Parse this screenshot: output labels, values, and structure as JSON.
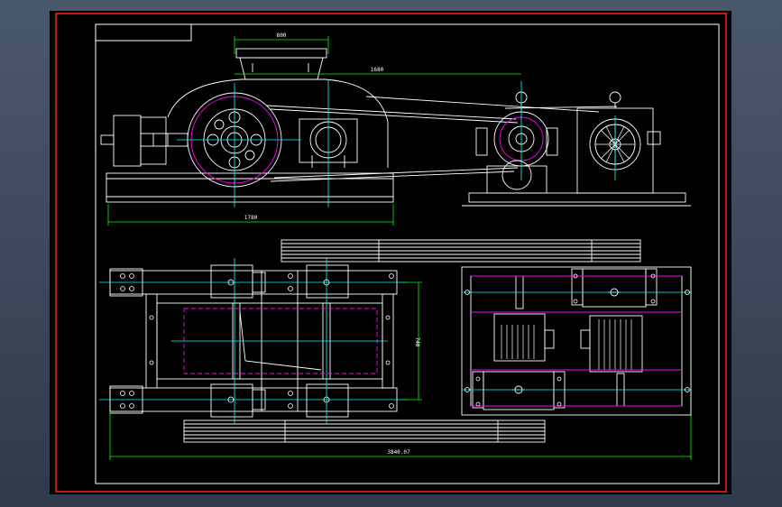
{
  "drawing": {
    "title": "",
    "dimensions": {
      "top_width": "800",
      "center_distance": "1680",
      "base_length": "1780",
      "side_height": "740",
      "overall_length": "3840.07"
    }
  },
  "colors": {
    "background": "#000000",
    "frame_red": "#ff2020",
    "lines_white": "#ffffff",
    "dimension_green": "#00ff00",
    "center_cyan": "#00ffff",
    "hidden_magenta": "#ff00ff"
  }
}
